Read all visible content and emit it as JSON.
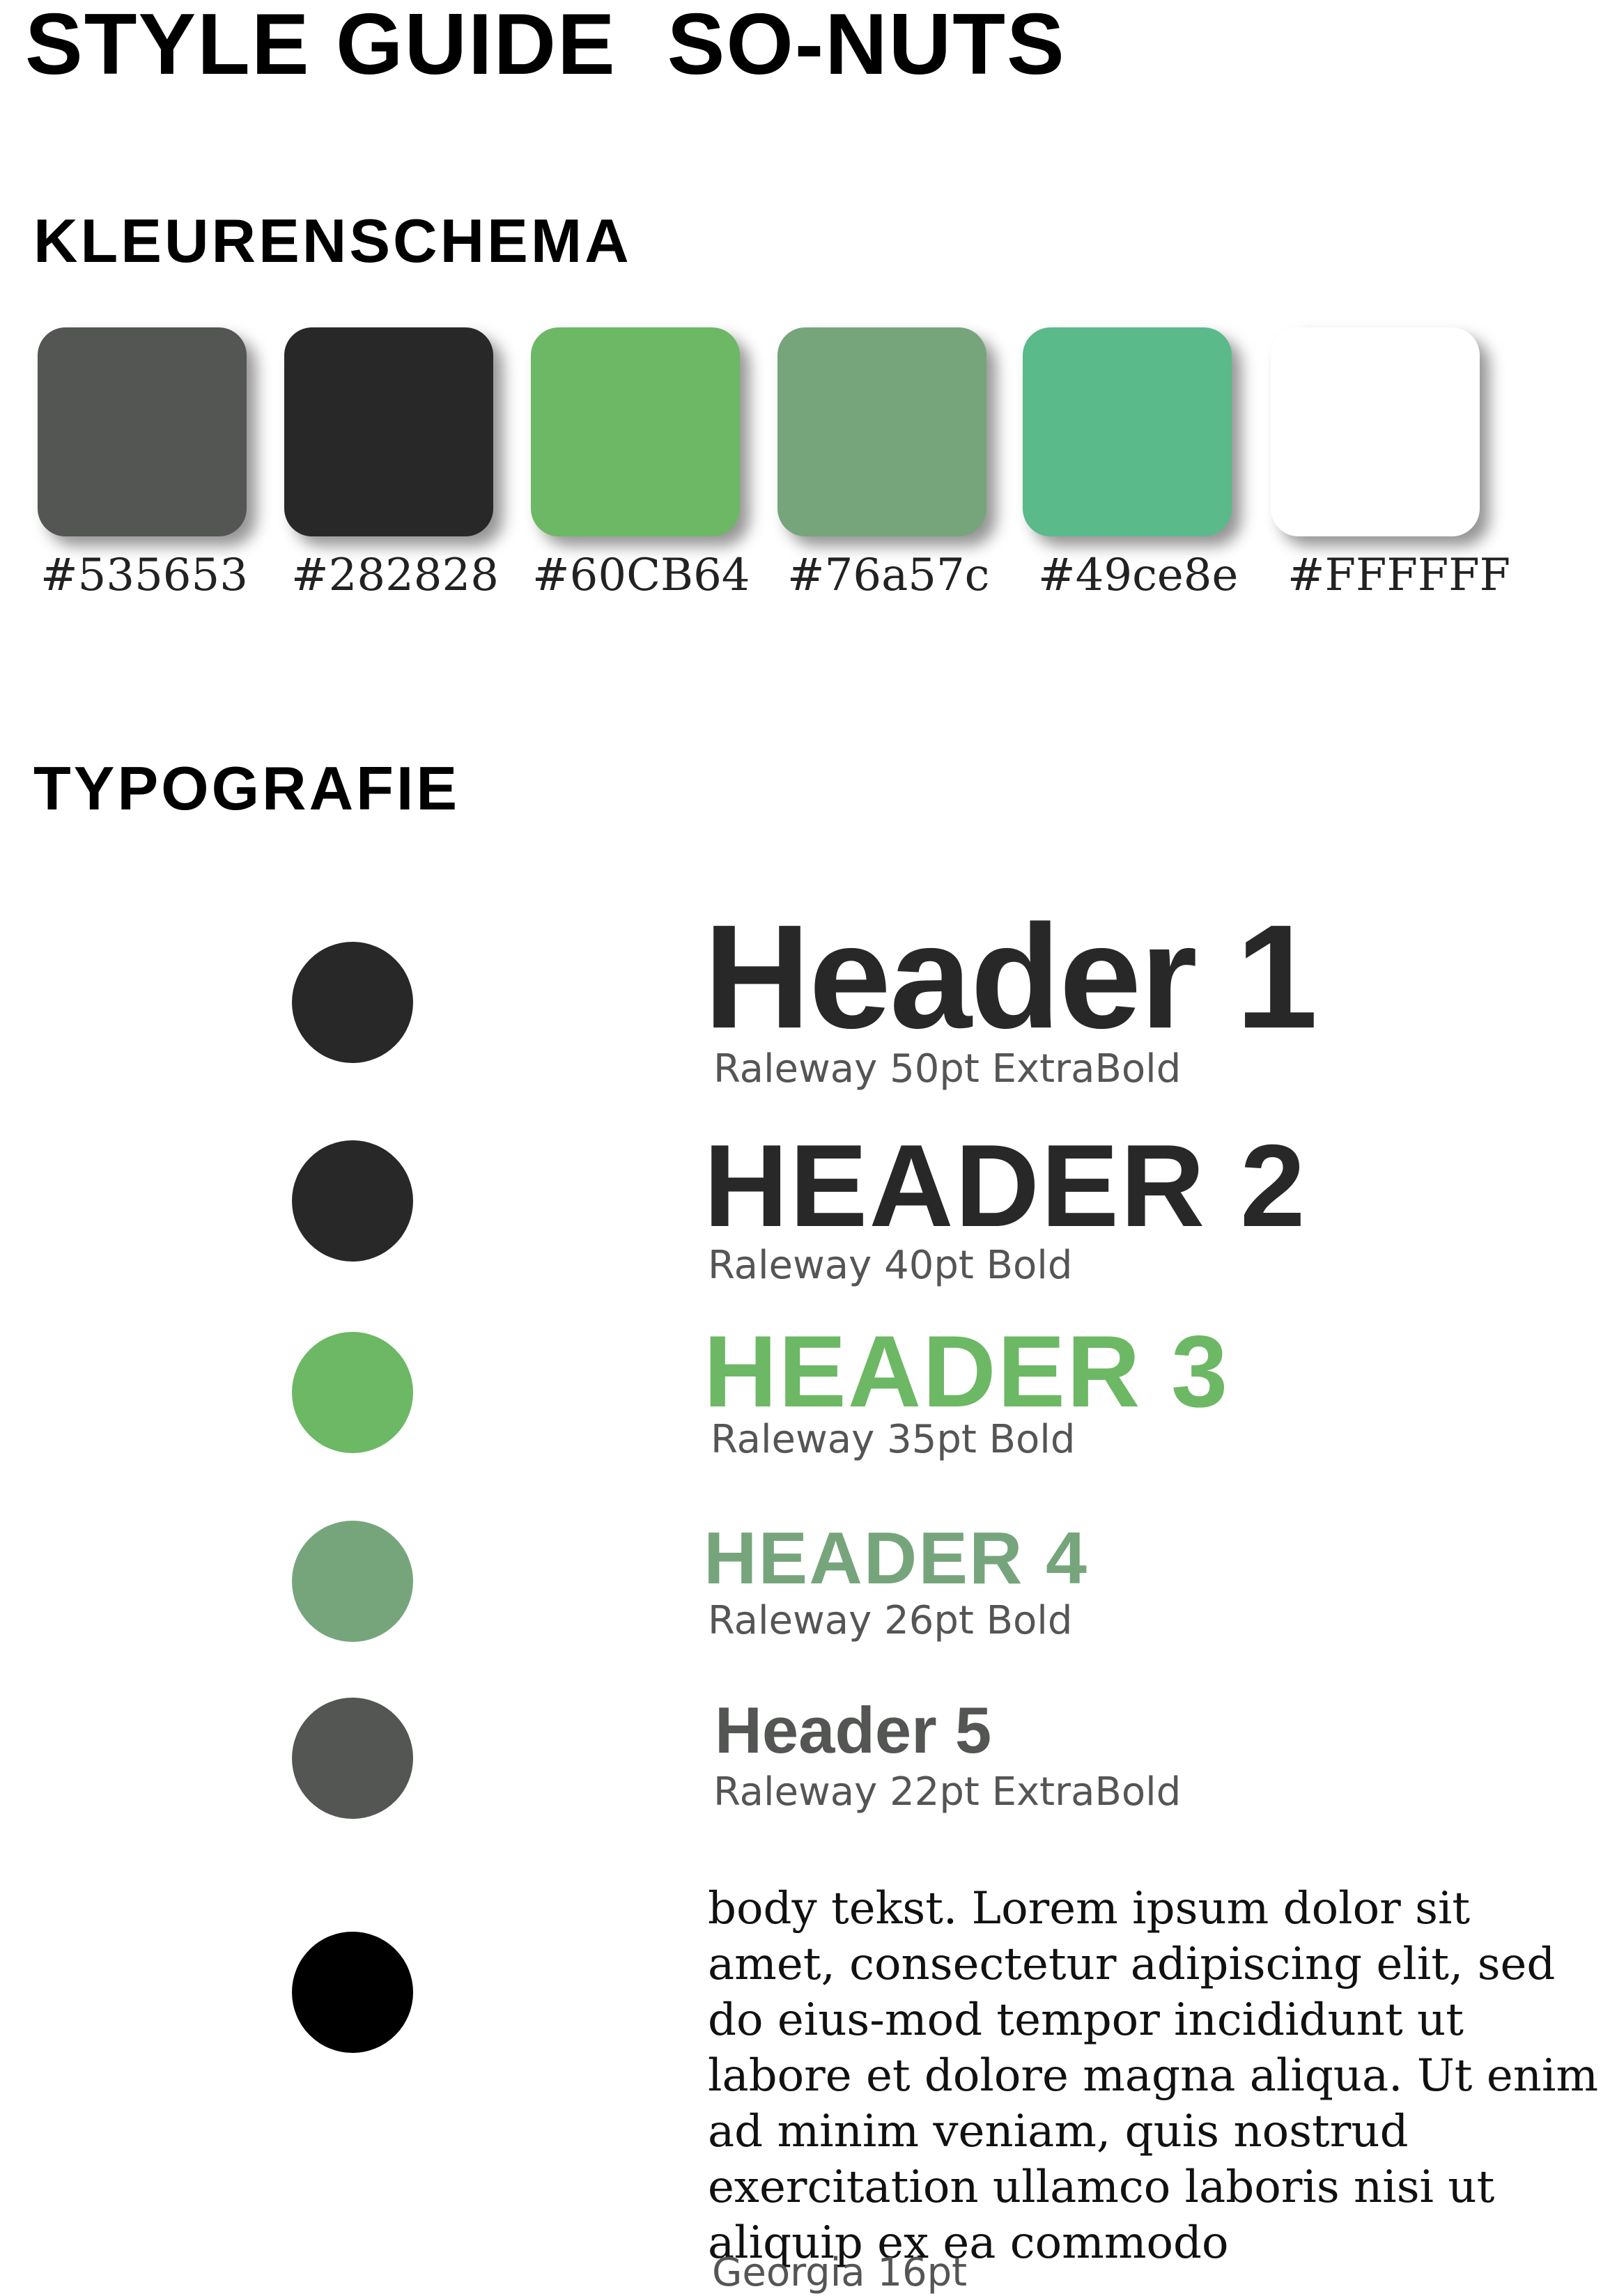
{
  "page": {
    "title": "STYLE GUIDE  SO-NUTS"
  },
  "colors": {
    "heading": "KLEURENSCHEMA",
    "swatches": [
      {
        "hex": "#535653",
        "label": "#535653"
      },
      {
        "hex": "#282828",
        "label": "#282828"
      },
      {
        "hex": "#6CB864",
        "label": "#60CB64"
      },
      {
        "hex": "#76a57c",
        "label": "#76a57c"
      },
      {
        "hex": "#5ABA8A",
        "label": "#49ce8e"
      },
      {
        "hex": "#FFFFFF",
        "label": "#FFFFFF"
      }
    ]
  },
  "typography": {
    "heading": "TYPOGRAFIE",
    "entries": [
      {
        "sample": "Header 1",
        "spec": "Raleway 50pt ExtraBold",
        "color": "#282828"
      },
      {
        "sample": "HEADER 2",
        "spec": "Raleway 40pt Bold",
        "color": "#282828"
      },
      {
        "sample": "HEADER 3",
        "spec": "Raleway 35pt Bold",
        "color": "#6CB864"
      },
      {
        "sample": "HEADER 4",
        "spec": "Raleway 26pt Bold",
        "color": "#76a57c"
      },
      {
        "sample": "Header 5",
        "spec": "Raleway 22pt ExtraBold",
        "color": "#535653"
      }
    ],
    "body": {
      "text": "body tekst. Lorem ipsum dolor sit amet, consectetur adipiscing elit, sed do eius-mod tempor incididunt ut labore et dolore magna aliqua. Ut enim ad minim veniam, quis nostrud exercitation ullamco laboris nisi ut aliquip ex ea commodo",
      "spec": "Georgia 16pt",
      "color": "#000000"
    }
  }
}
